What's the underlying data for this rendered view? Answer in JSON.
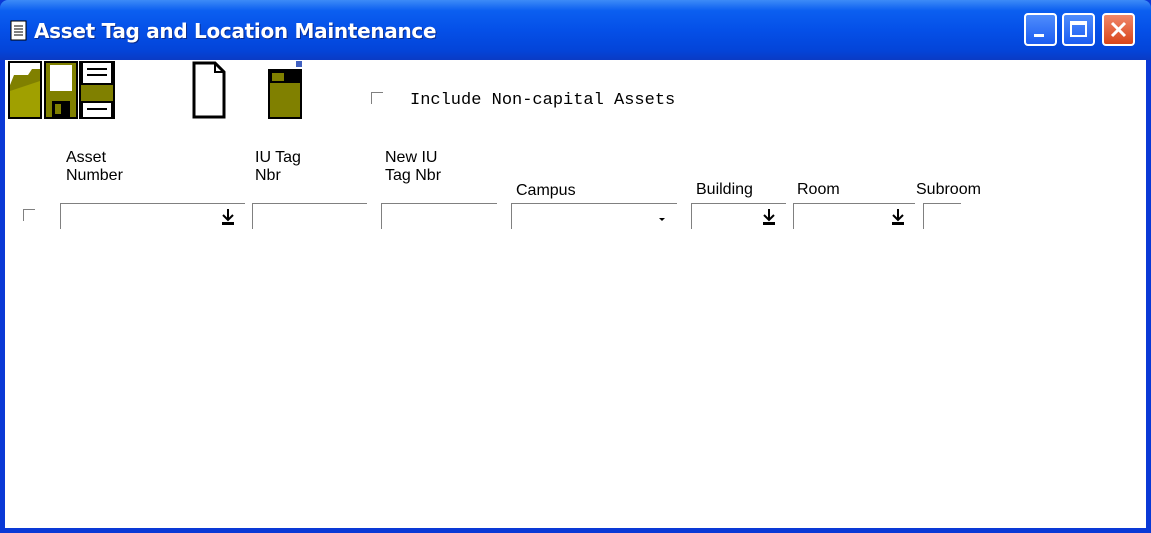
{
  "window": {
    "title": "Asset Tag and Location Maintenance"
  },
  "toolbar": {
    "icons": [
      "open-icon",
      "save-icon",
      "print-icon",
      "new-icon",
      "open-folder-icon"
    ]
  },
  "options": {
    "include_noncapital_label": "Include Non-capital Assets",
    "include_noncapital_checked": false
  },
  "columns": {
    "asset_number": "Asset\nNumber",
    "iu_tag_nbr": "IU Tag\nNbr",
    "new_iu_tag_nbr": "New IU\nTag Nbr",
    "campus": "Campus",
    "building": "Building",
    "room": "Room",
    "subroom": "Subroom"
  },
  "row": {
    "selected": false,
    "asset_number": "",
    "iu_tag_nbr": "",
    "new_iu_tag_nbr": "",
    "campus": "",
    "building": "",
    "room": "",
    "subroom": ""
  },
  "colors": {
    "titlebar": "#0550e8",
    "toolbar_icon": "#808000",
    "close_button": "#d8451a"
  }
}
